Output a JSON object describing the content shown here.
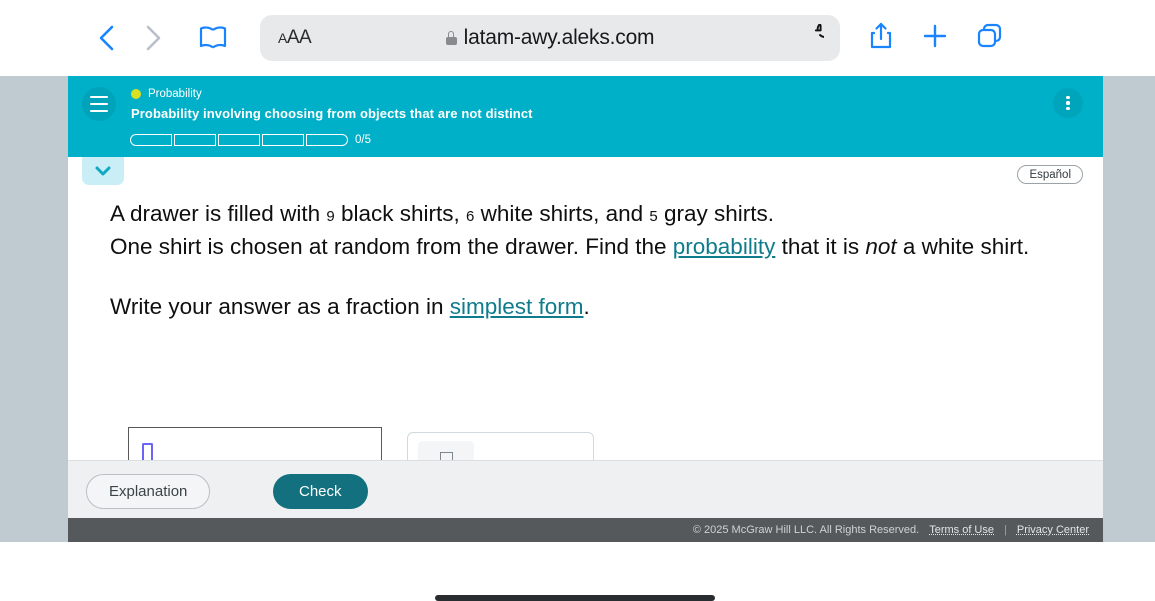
{
  "browser": {
    "back_icon": "chevron-left-icon",
    "forward_icon": "chevron-right-icon",
    "bookmarks_icon": "book-icon",
    "text_size_label": "AA",
    "lock_icon": "lock-icon",
    "url": "latam-awy.aleks.com",
    "reload_icon": "reload-icon",
    "share_icon": "share-icon",
    "new_tab_icon": "plus-icon",
    "tabs_icon": "tabs-icon"
  },
  "header": {
    "menu_icon": "hamburger-menu-icon",
    "topic_dot_color": "#d9e021",
    "topic": "Probability",
    "title": "Probability involving choosing from objects that are not distinct",
    "progress": {
      "segments": 5,
      "completed": 0,
      "count_label": "0/5"
    },
    "overflow_icon": "kebab-menu-icon",
    "background_color": "#00b0c8"
  },
  "content": {
    "collapse_icon": "chevron-down-icon",
    "language_button": "Español",
    "problem": {
      "line1_a": "A drawer is filled with ",
      "black_count": "9",
      "line1_b": " black shirts, ",
      "white_count": "6",
      "line1_c": " white shirts, and ",
      "gray_count": "5",
      "line1_d": " gray shirts.",
      "line2_a": "One shirt is chosen at random from the drawer. Find the ",
      "probability_link": "probability",
      "line2_b": " that it is ",
      "not_word": "not",
      "line2_c": " a white shirt."
    },
    "instruction": {
      "prefix": "Write your answer as a fraction in ",
      "link": "simplest form",
      "suffix": "."
    },
    "answer": {
      "value": "",
      "caret_color": "#6c63f7"
    },
    "math_toolbar": {
      "fraction_icon": "fraction-icon",
      "clear_icon": "clear-x-icon",
      "clear_glyph": "✕",
      "undo_icon": "undo-icon",
      "undo_glyph": "↺"
    }
  },
  "actions": {
    "explanation_label": "Explanation",
    "check_label": "Check",
    "check_color": "#12707f"
  },
  "footer": {
    "copyright": "© 2025 McGraw Hill LLC. All Rights Reserved.",
    "terms_label": "Terms of Use",
    "separator": "|",
    "privacy_label": "Privacy Center"
  }
}
